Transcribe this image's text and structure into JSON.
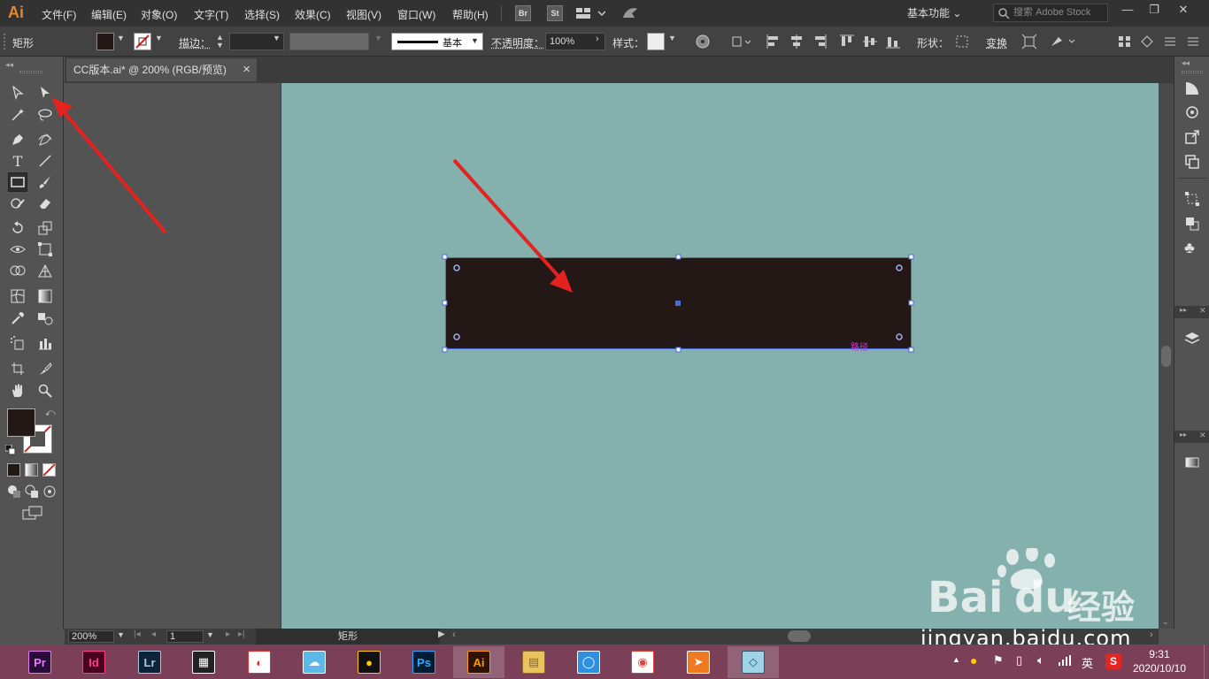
{
  "app": {
    "logo": "Ai",
    "menus": [
      "文件(F)",
      "编辑(E)",
      "对象(O)",
      "文字(T)",
      "选择(S)",
      "效果(C)",
      "视图(V)",
      "窗口(W)",
      "帮助(H)"
    ],
    "bridge_label": "Br",
    "stock_label": "St",
    "workspace": "基本功能",
    "search_placeholder": "搜索 Adobe Stock"
  },
  "control_bar": {
    "object_type": "矩形",
    "stroke_label": "描边：",
    "stroke_style": "基本",
    "opacity_label": "不透明度：",
    "opacity_value": "100%",
    "style_label": "样式：",
    "shape_label": "形状：",
    "transform_label": "变换"
  },
  "document": {
    "tab_title": "CC版本.ai* @ 200% (RGB/预览)",
    "path_label": "路径"
  },
  "status": {
    "zoom": "200%",
    "page": "1",
    "tool_name": "矩形"
  },
  "taskbar": {
    "apps": [
      {
        "label": "Pr",
        "bg": "#2a0c3a",
        "fg": "#e77cf8"
      },
      {
        "label": "Id",
        "bg": "#49021f",
        "fg": "#ff3d8b"
      },
      {
        "label": "Lr",
        "bg": "#0f2336",
        "fg": "#a9c8e6"
      },
      {
        "label": "▦",
        "bg": "#222",
        "fg": "#fff"
      },
      {
        "label": "◐",
        "bg": "#fff",
        "fg": "#d33"
      },
      {
        "label": "☁",
        "bg": "#5cb8e8",
        "fg": "#fff"
      },
      {
        "label": "●",
        "bg": "#111",
        "fg": "#fc0"
      },
      {
        "label": "Ps",
        "bg": "#001d34",
        "fg": "#31a8ff"
      },
      {
        "label": "Ai",
        "bg": "#2e1400",
        "fg": "#ff9a00"
      },
      {
        "label": "▤",
        "bg": "#e9c35c",
        "fg": "#8a6a2a"
      },
      {
        "label": "◯",
        "bg": "#2f8fe0",
        "fg": "#fff"
      },
      {
        "label": "◉",
        "bg": "#fff",
        "fg": "#db4437"
      },
      {
        "label": "➤",
        "bg": "#f07a22",
        "fg": "#fff"
      },
      {
        "label": "◇",
        "bg": "#9fd3e8",
        "fg": "#356"
      }
    ],
    "ime": "英",
    "time": "9:31",
    "date": "2020/10/10"
  },
  "watermark": {
    "brand": "Bai",
    "brand2": "du",
    "cn": "经验",
    "url": "jingyan.baidu.com"
  }
}
